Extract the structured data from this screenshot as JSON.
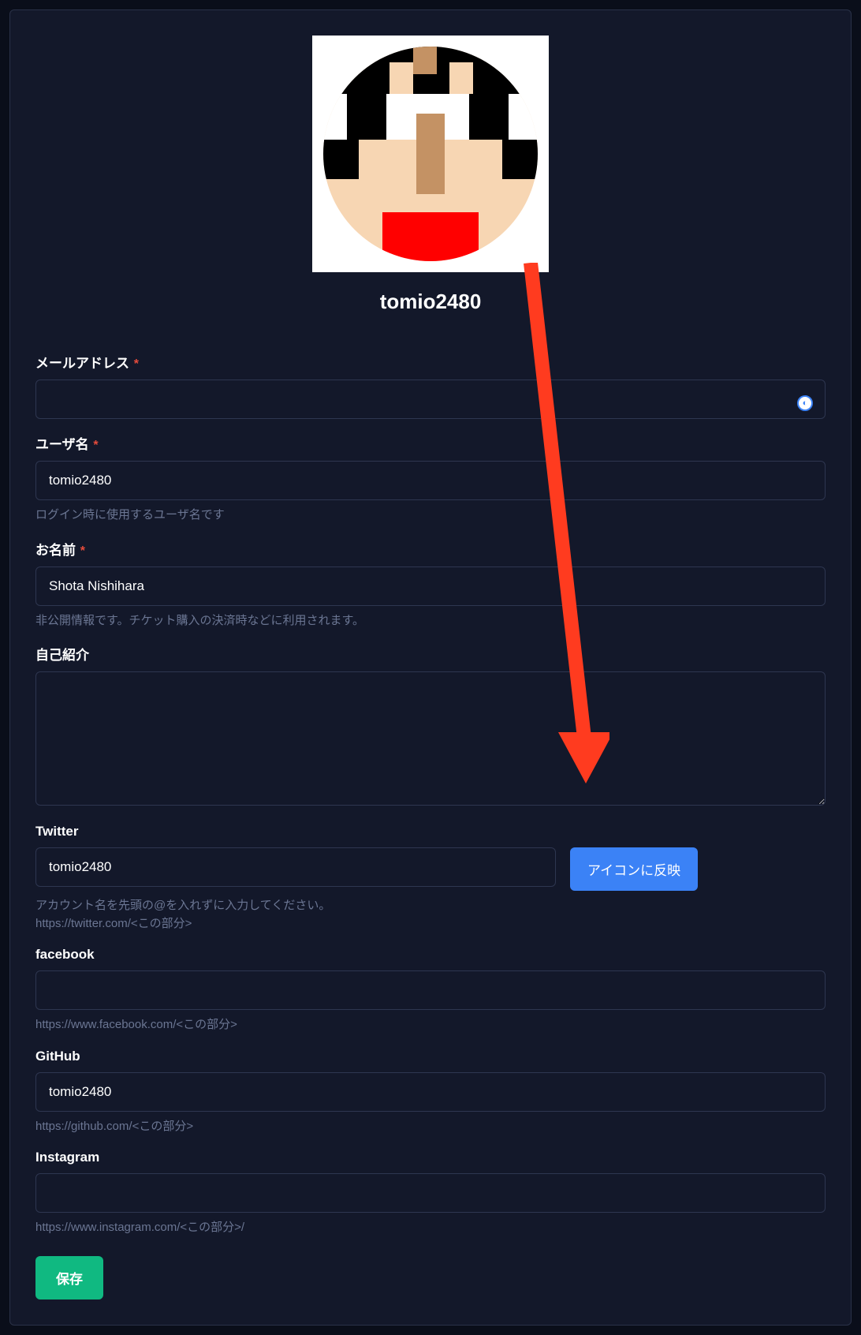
{
  "profile": {
    "username_display": "tomio2480"
  },
  "fields": {
    "email": {
      "label": "メールアドレス",
      "value": ""
    },
    "username": {
      "label": "ユーザ名",
      "value": "tomio2480",
      "help": "ログイン時に使用するユーザ名です"
    },
    "name": {
      "label": "お名前",
      "value": "Shota Nishihara",
      "help": "非公開情報です。チケット購入の決済時などに利用されます。"
    },
    "bio": {
      "label": "自己紹介",
      "value": ""
    },
    "twitter": {
      "label": "Twitter",
      "value": "tomio2480",
      "help_line1": "アカウント名を先頭の@を入れずに入力してください。",
      "help_line2": "https://twitter.com/<この部分>",
      "reflect_button": "アイコンに反映"
    },
    "facebook": {
      "label": "facebook",
      "value": "",
      "help": "https://www.facebook.com/<この部分>"
    },
    "github": {
      "label": "GitHub",
      "value": "tomio2480",
      "help": "https://github.com/<この部分>"
    },
    "instagram": {
      "label": "Instagram",
      "value": "",
      "help": "https://www.instagram.com/<この部分>/"
    }
  },
  "buttons": {
    "save": "保存"
  }
}
